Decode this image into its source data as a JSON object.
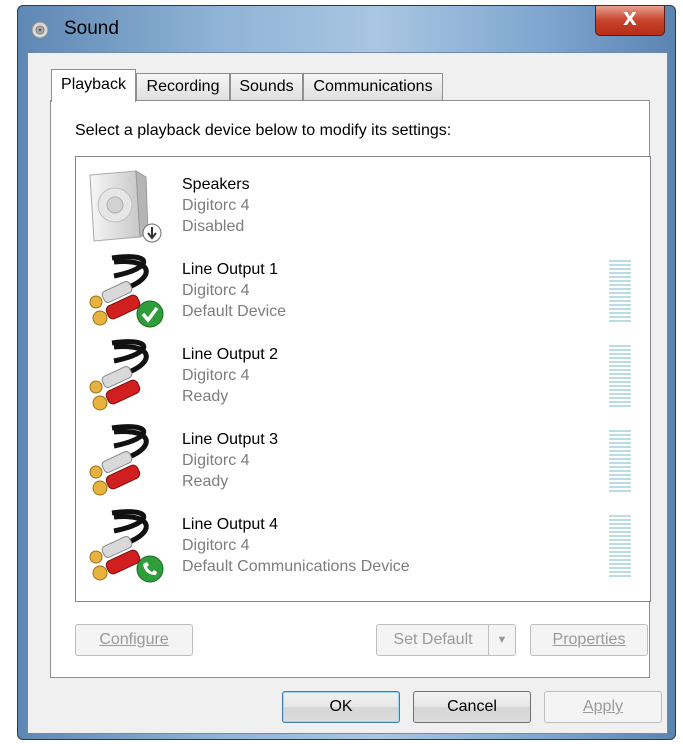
{
  "window": {
    "title": "Sound",
    "close_label": "X"
  },
  "tabs": [
    {
      "label": "Playback"
    },
    {
      "label": "Recording"
    },
    {
      "label": "Sounds"
    },
    {
      "label": "Communications"
    }
  ],
  "instruction": "Select a playback device below to modify its settings:",
  "devices": [
    {
      "name": "Speakers",
      "driver": "Digitorc 4",
      "status": "Disabled",
      "icon": "speaker-icon",
      "badge": "disabled-arrow-badge"
    },
    {
      "name": "Line Output 1",
      "driver": "Digitorc 4",
      "status": "Default Device",
      "icon": "rca-cable-icon",
      "badge": "default-check-badge"
    },
    {
      "name": "Line Output 2",
      "driver": "Digitorc 4",
      "status": "Ready",
      "icon": "rca-cable-icon"
    },
    {
      "name": "Line Output 3",
      "driver": "Digitorc 4",
      "status": "Ready",
      "icon": "rca-cable-icon"
    },
    {
      "name": "Line Output 4",
      "driver": "Digitorc 4",
      "status": "Default Communications Device",
      "icon": "rca-cable-icon",
      "badge": "phone-badge"
    }
  ],
  "buttons": {
    "configure": "Configure",
    "set_default": "Set Default",
    "properties": "Properties",
    "ok": "OK",
    "cancel": "Cancel",
    "apply": "Apply"
  },
  "colors": {
    "accent": "#3c7fb1",
    "meter": "#b9dde3",
    "check_green": "#2e9d3a",
    "close_red": "#c7432c"
  }
}
